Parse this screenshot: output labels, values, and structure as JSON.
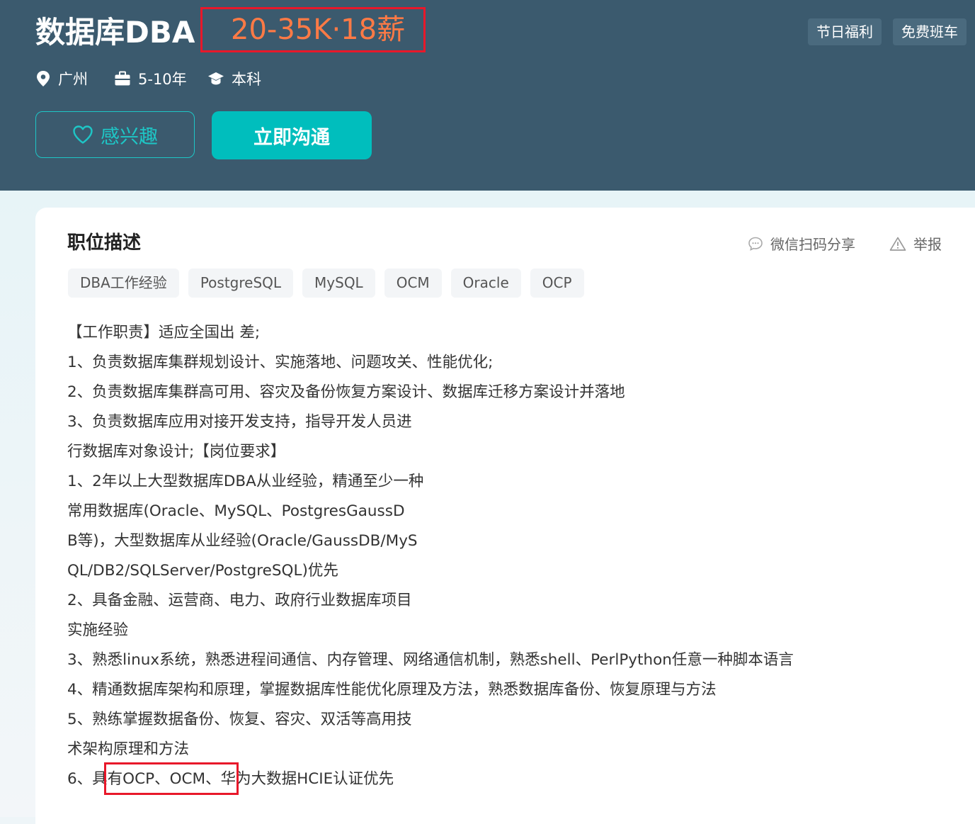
{
  "job": {
    "title": "数据库DBA",
    "salary": "20-35K·18薪",
    "welfare": [
      "节日福利",
      "免费班车"
    ],
    "location": "广州",
    "experience": "5-10年",
    "degree": "本科"
  },
  "actions": {
    "interest_label": "感兴趣",
    "chat_label": "立即沟通"
  },
  "description": {
    "section_title": "职位描述",
    "share_label": "微信扫码分享",
    "report_label": "举报",
    "tags": [
      "DBA工作经验",
      "PostgreSQL",
      "MySQL",
      "OCM",
      "Oracle",
      "OCP"
    ],
    "lines": [
      "【工作职责】适应全国出 差;",
      "1、负责数据库集群规划设计、实施落地、问题攻关、性能优化;",
      "2、负责数据库集群高可用、容灾及备份恢复方案设计、数据库迁移方案设计并落地",
      "3、负责数据库应用对接开发支持，指导开发人员进",
      "行数据库对象设计;【岗位要求】",
      "1、2年以上大型数据库DBA从业经验，精通至少一种",
      "常用数据库(Oracle、MySQL、PostgresGaussD",
      "B等)，大型数据库从业经验(Oracle/GaussDB/MyS",
      "QL/DB2/SQLServer/PostgreSQL)优先",
      "2、具备金融、运营商、电力、政府行业数据库项目",
      "实施经验",
      "3、熟悉linux系统，熟悉进程间通信、内存管理、网络通信机制，熟悉shell、PerlPython任意一种脚本语言",
      "4、精通数据库架构和原理，掌握数据库性能优化原理及方法，熟悉数据库备份、恢复原理与方法",
      "5、熟练掌握数据备份、恢复、容灾、双活等高用技",
      "术架构原理和方法",
      "6、具有OCP、OCM、华为大数据HCIE认证优先"
    ]
  },
  "colors": {
    "header_bg": "#3b5a6e",
    "salary": "#ff7a45",
    "accent": "#00bebd",
    "highlight_box": "#e8182a"
  },
  "icons": {
    "location": "location-pin-icon",
    "experience": "briefcase-icon",
    "degree": "graduation-cap-icon",
    "interest": "heart-icon",
    "share": "chat-bubble-icon",
    "report": "warning-triangle-icon"
  }
}
